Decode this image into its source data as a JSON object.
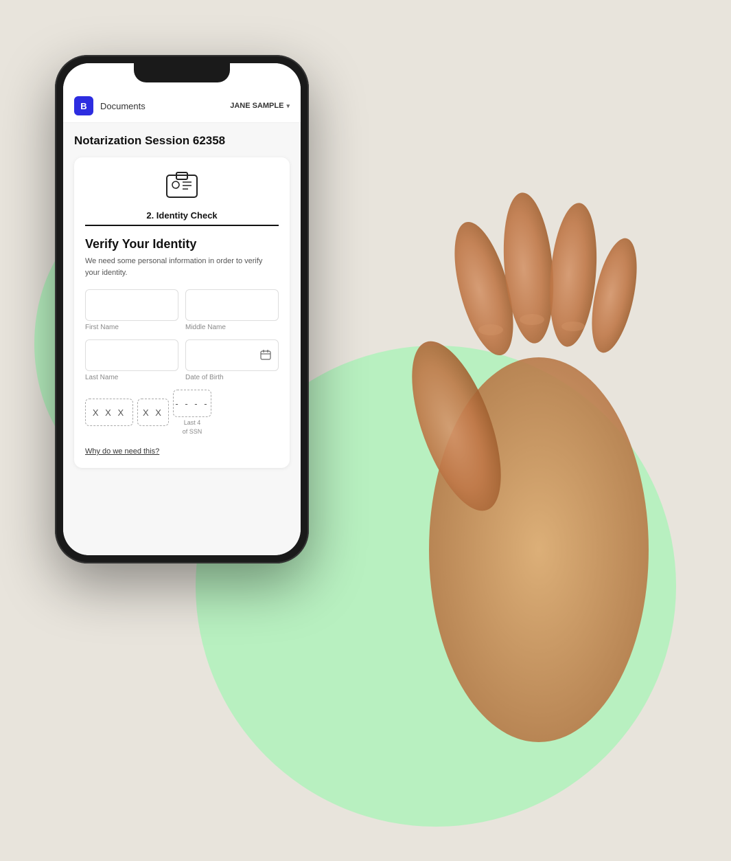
{
  "background": {
    "color": "#e8e4dc",
    "blob_color": "#b8f0c0"
  },
  "nav": {
    "logo_letter": "B",
    "logo_color": "#2d2de0",
    "documents_label": "Documents",
    "user_name": "JANE SAMPLE",
    "chevron": "▾"
  },
  "page": {
    "title": "Notarization Session 62358",
    "step": {
      "number": "2. Identity Check",
      "icon_alt": "identity-badge-icon"
    },
    "verify": {
      "title": "Verify Your Identity",
      "description": "We need some personal information in order to verify your identity."
    },
    "form": {
      "first_name_label": "First Name",
      "first_name_placeholder": "",
      "middle_name_label": "Middle Name",
      "middle_name_placeholder": "",
      "last_name_label": "Last Name",
      "last_name_placeholder": "",
      "dob_label": "Date of Birth",
      "dob_placeholder": "",
      "ssn_seg1": "X X X",
      "ssn_seg2": "X X",
      "ssn_seg3": "- - - -",
      "ssn_last4_label": "Last 4",
      "ssn_of_label": "of SSN",
      "why_link": "Why do we need this?"
    }
  }
}
